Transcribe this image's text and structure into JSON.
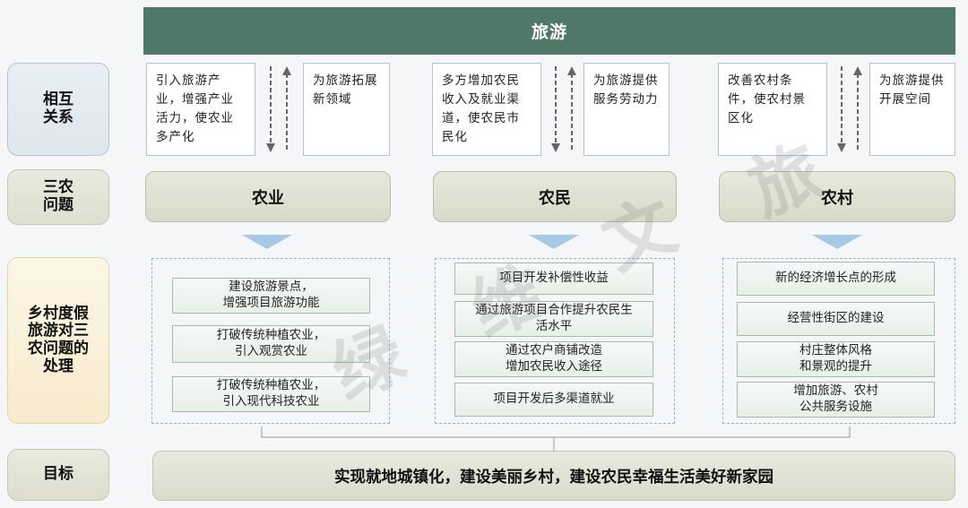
{
  "top": {
    "title": "旅游"
  },
  "side_labels": {
    "interaction": "相互\n关系",
    "sannong": "三农\n问题",
    "process": "乡村度假\n旅游对三\n农问题的\n处理",
    "goal": "目标"
  },
  "columns": [
    {
      "left_text": "引入旅游产业，增强产业活力，使农业多产化",
      "right_text": "为旅游拓展新领域",
      "issue": "农业",
      "items": [
        "建设旅游景点，\n增强项目旅游功能",
        "打破传统种植农业，\n引入观赏农业",
        "打破传统种植农业，\n引入现代科技农业"
      ]
    },
    {
      "left_text": "多方增加农民收入及就业渠道，使农民市民化",
      "right_text": "为旅游提供服务劳动力",
      "issue": "农民",
      "items": [
        "项目开发补偿性收益",
        "通过旅游项目合作提升农民生\n活水平",
        "通过农户商铺改造\n增加农民收入途径",
        "项目开发后多渠道就业"
      ]
    },
    {
      "left_text": "改善农村条件，使农村景区化",
      "right_text": "为旅游提供开展空间",
      "issue": "农村",
      "items": [
        "新的经济增长点的形成",
        "经营性街区的建设",
        "村庄整体风格\n和景观的提升",
        "增加旅游、农村\n公共服务设施"
      ]
    }
  ],
  "goal": {
    "text": "实现就地城镇化，建设美丽乡村，建设农民幸福生活美好新家园"
  },
  "watermark_chars": [
    "绿",
    "维",
    "文",
    "旅"
  ],
  "colors": {
    "top_bar": "#4f7868",
    "group_border": "#9eb1bd",
    "chevron": "#a9c8e2"
  }
}
